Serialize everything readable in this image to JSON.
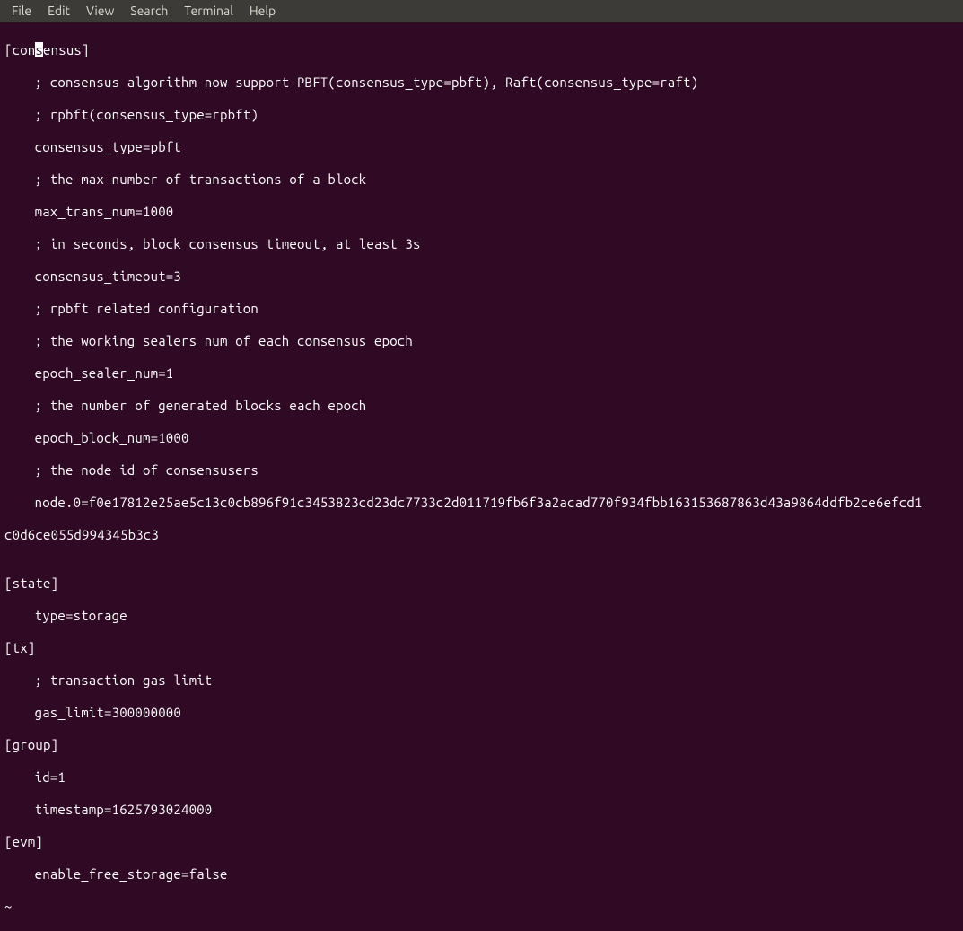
{
  "menubar": {
    "file": "File",
    "edit": "Edit",
    "view": "View",
    "search": "Search",
    "terminal": "Terminal",
    "help": "Help"
  },
  "file_content": {
    "cursor_pre": "[con",
    "cursor_char": "s",
    "cursor_post": "ensus]",
    "l2": "; consensus algorithm now support PBFT(consensus_type=pbft), Raft(consensus_type=raft)",
    "l3": "; rpbft(consensus_type=rpbft)",
    "l4": "consensus_type=pbft",
    "l5": "; the max number of transactions of a block",
    "l6": "max_trans_num=1000",
    "l7": "; in seconds, block consensus timeout, at least 3s",
    "l8": "consensus_timeout=3",
    "l9": "; rpbft related configuration",
    "l10": "; the working sealers num of each consensus epoch",
    "l11": "epoch_sealer_num=1",
    "l12": "; the number of generated blocks each epoch",
    "l13": "epoch_block_num=1000",
    "l14": "; the node id of consensusers",
    "l15": "node.0=f0e17812e25ae5c13c0cb896f91c3453823cd23dc7733c2d011719fb6f3a2acad770f934fbb163153687863d43a9864ddfb2ce6efcd1",
    "l16": "c0d6ce055d994345b3c3",
    "l17": "",
    "l18": "[state]",
    "l19": "type=storage",
    "l20": "[tx]",
    "l21": "; transaction gas limit",
    "l22": "gas_limit=300000000",
    "l23": "[group]",
    "l24": "id=1",
    "l25": "timestamp=1625793024000",
    "l26": "[evm]",
    "l27": "enable_free_storage=false",
    "tilde": "~"
  }
}
